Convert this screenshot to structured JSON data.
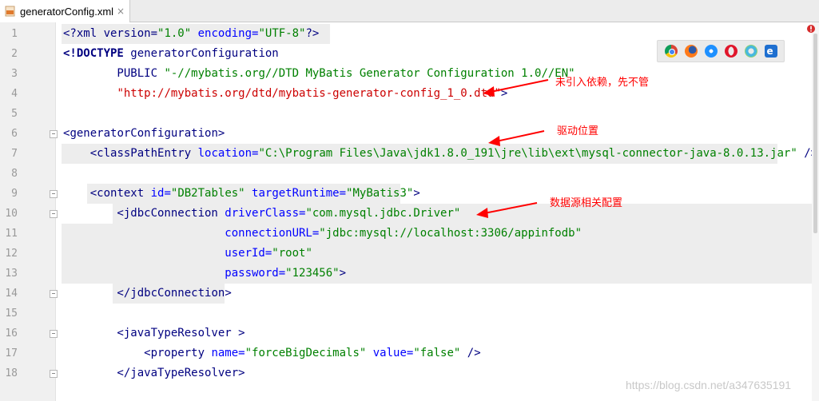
{
  "tab": {
    "filename": "generatorConfig.xml",
    "close": "×"
  },
  "lines": [
    "1",
    "2",
    "3",
    "4",
    "5",
    "6",
    "7",
    "8",
    "9",
    "10",
    "11",
    "12",
    "13",
    "14",
    "15",
    "16",
    "17",
    "18"
  ],
  "code": {
    "l1": {
      "a": "<?xml version=",
      "b": "\"1.0\"",
      "c": " encoding=",
      "d": "\"UTF-8\"",
      "e": "?>"
    },
    "l2": {
      "a": "<!DOCTYPE ",
      "b": "generatorConfiguration"
    },
    "l3": {
      "a": "        PUBLIC ",
      "b": "\"-//mybatis.org//DTD MyBatis Generator Configuration 1.0//EN\""
    },
    "l4": {
      "a": "        ",
      "b": "\"http://mybatis.org/dtd/mybatis-generator-config_1_0.dtd\"",
      "c": ">"
    },
    "l6": {
      "a": "<",
      "b": "generatorConfiguration",
      "c": ">"
    },
    "l7": {
      "a": "    <",
      "b": "classPathEntry",
      "c": " location=",
      "d": "\"C:\\Program Files\\Java\\jdk1.8.0_191\\jre\\lib\\ext\\mysql-connector-java-8.0.13.jar\"",
      "e": " />"
    },
    "l9": {
      "a": "    <",
      "b": "context",
      "c": " id=",
      "d": "\"DB2Tables\"",
      "e": " targetRuntime=",
      "f": "\"MyBatis3\"",
      "g": ">"
    },
    "l10": {
      "a": "        <",
      "b": "jdbcConnection",
      "c": " driverClass=",
      "d": "\"com.mysql.jdbc.Driver\""
    },
    "l11": {
      "a": "                        connectionURL=",
      "b": "\"jdbc:mysql://localhost:3306/appinfodb\""
    },
    "l12": {
      "a": "                        userId=",
      "b": "\"root\""
    },
    "l13": {
      "a": "                        password=",
      "b": "\"123456\"",
      "c": ">"
    },
    "l14": {
      "a": "        </",
      "b": "jdbcConnection",
      "c": ">"
    },
    "l16": {
      "a": "        <",
      "b": "javaTypeResolver",
      "c": " >"
    },
    "l17": {
      "a": "            <",
      "b": "property",
      "c": " name=",
      "d": "\"forceBigDecimals\"",
      "e": " value=",
      "f": "\"false\"",
      "g": " />"
    },
    "l18": {
      "a": "        </",
      "b": "javaTypeResolver",
      "c": ">"
    }
  },
  "annotations": {
    "dependency": "未引入依赖，先不管",
    "driver": "驱动位置",
    "datasource": "数据源相关配置"
  },
  "watermark": "https://blog.csdn.net/a347635191",
  "colors": {
    "tag": "#000080",
    "attr": "#0000ff",
    "value": "#008000",
    "annotation": "#ff0000"
  },
  "browsers": [
    "chrome-icon",
    "firefox-icon",
    "safari-icon",
    "opera-icon",
    "ie-old-icon",
    "edge-icon"
  ]
}
